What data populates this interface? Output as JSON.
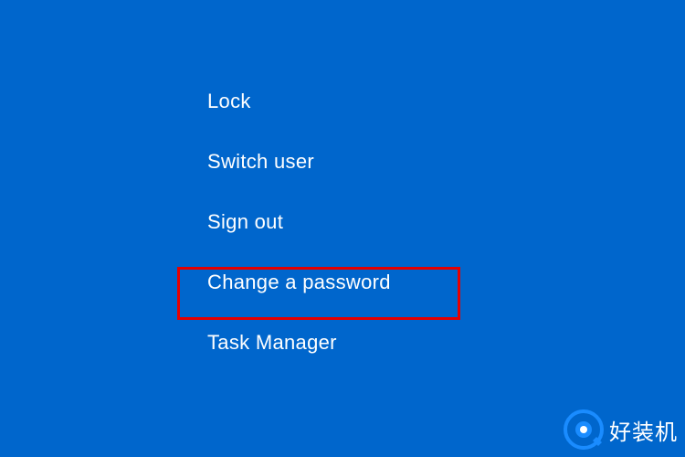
{
  "menu": {
    "items": [
      {
        "label": "Lock"
      },
      {
        "label": "Switch user"
      },
      {
        "label": "Sign out"
      },
      {
        "label": "Change a password"
      },
      {
        "label": "Task Manager"
      }
    ]
  },
  "watermark": {
    "text": "好装机"
  }
}
